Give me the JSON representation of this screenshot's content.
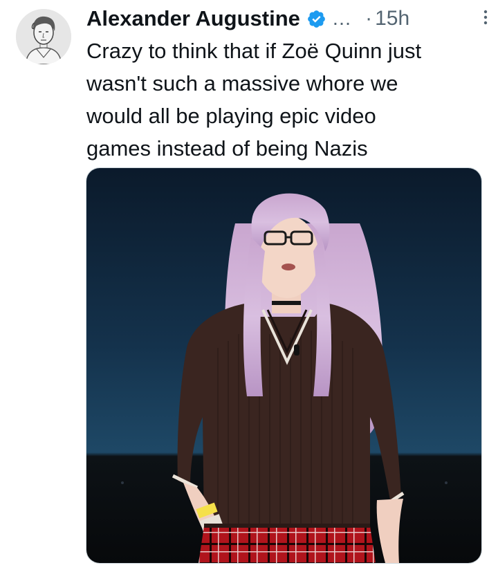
{
  "tweet": {
    "author": {
      "display_name": "Alexander Augustine",
      "verified_icon": "verified-badge-icon",
      "handle_truncated": "...",
      "avatar_icon": "sketch-portrait-avatar"
    },
    "separator": "·",
    "time": "15h",
    "more_icon": "more-vertical-icon",
    "text": "Crazy to think that if Zoë Quinn just\nwasn't such a massive whore we\nwould all be playing epic video\ngames instead of being Nazis",
    "media": {
      "kind": "photo",
      "icon": "photo-person-on-stage"
    }
  },
  "colors": {
    "primary_text": "#0f1419",
    "secondary_text": "#536471",
    "verified_blue": "#1d9bf0",
    "media_border": "#cfd9de"
  }
}
